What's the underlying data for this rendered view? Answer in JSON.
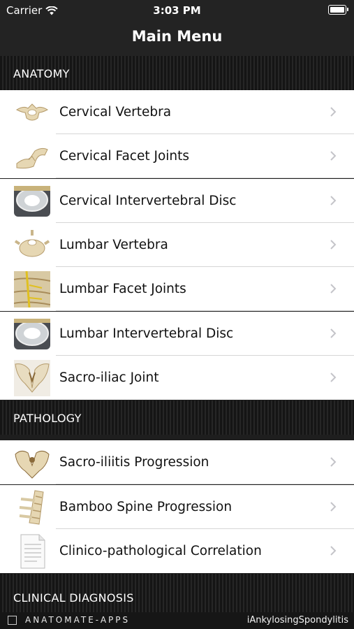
{
  "status_bar": {
    "carrier": "Carrier",
    "time": "3:03 PM"
  },
  "nav": {
    "title": "Main Menu"
  },
  "sections": [
    {
      "title": "ANATOMY",
      "items": [
        {
          "label": "Cervical Vertebra",
          "icon": "cervical-vertebra-icon"
        },
        {
          "label": "Cervical Facet Joints",
          "icon": "cervical-facet-joints-icon"
        },
        {
          "label": "Cervical Intervertebral Disc",
          "icon": "cervical-disc-icon"
        },
        {
          "label": "Lumbar Vertebra",
          "icon": "lumbar-vertebra-icon"
        },
        {
          "label": "Lumbar Facet Joints",
          "icon": "lumbar-facet-joints-icon"
        },
        {
          "label": "Lumbar Intervertebral Disc",
          "icon": "lumbar-disc-icon"
        },
        {
          "label": "Sacro-iliac Joint",
          "icon": "sacro-iliac-joint-icon"
        }
      ]
    },
    {
      "title": "PATHOLOGY",
      "items": [
        {
          "label": "Sacro-iliitis Progression",
          "icon": "pelvis-icon"
        },
        {
          "label": "Bamboo Spine Progression",
          "icon": "spine-icon"
        },
        {
          "label": "Clinico-pathological Correlation",
          "icon": "document-icon"
        }
      ]
    },
    {
      "title": "CLINICAL DIAGNOSIS",
      "items": []
    }
  ],
  "footer": {
    "brand": "ANATOMATE-APPS",
    "app_name": "iAnkylosingSpondylitis"
  },
  "colors": {
    "bar": "#232323",
    "row_bg": "#ffffff",
    "divider": "#d6d6d6",
    "chevron": "#c4c4c9",
    "bone": "#e8dcc0"
  }
}
